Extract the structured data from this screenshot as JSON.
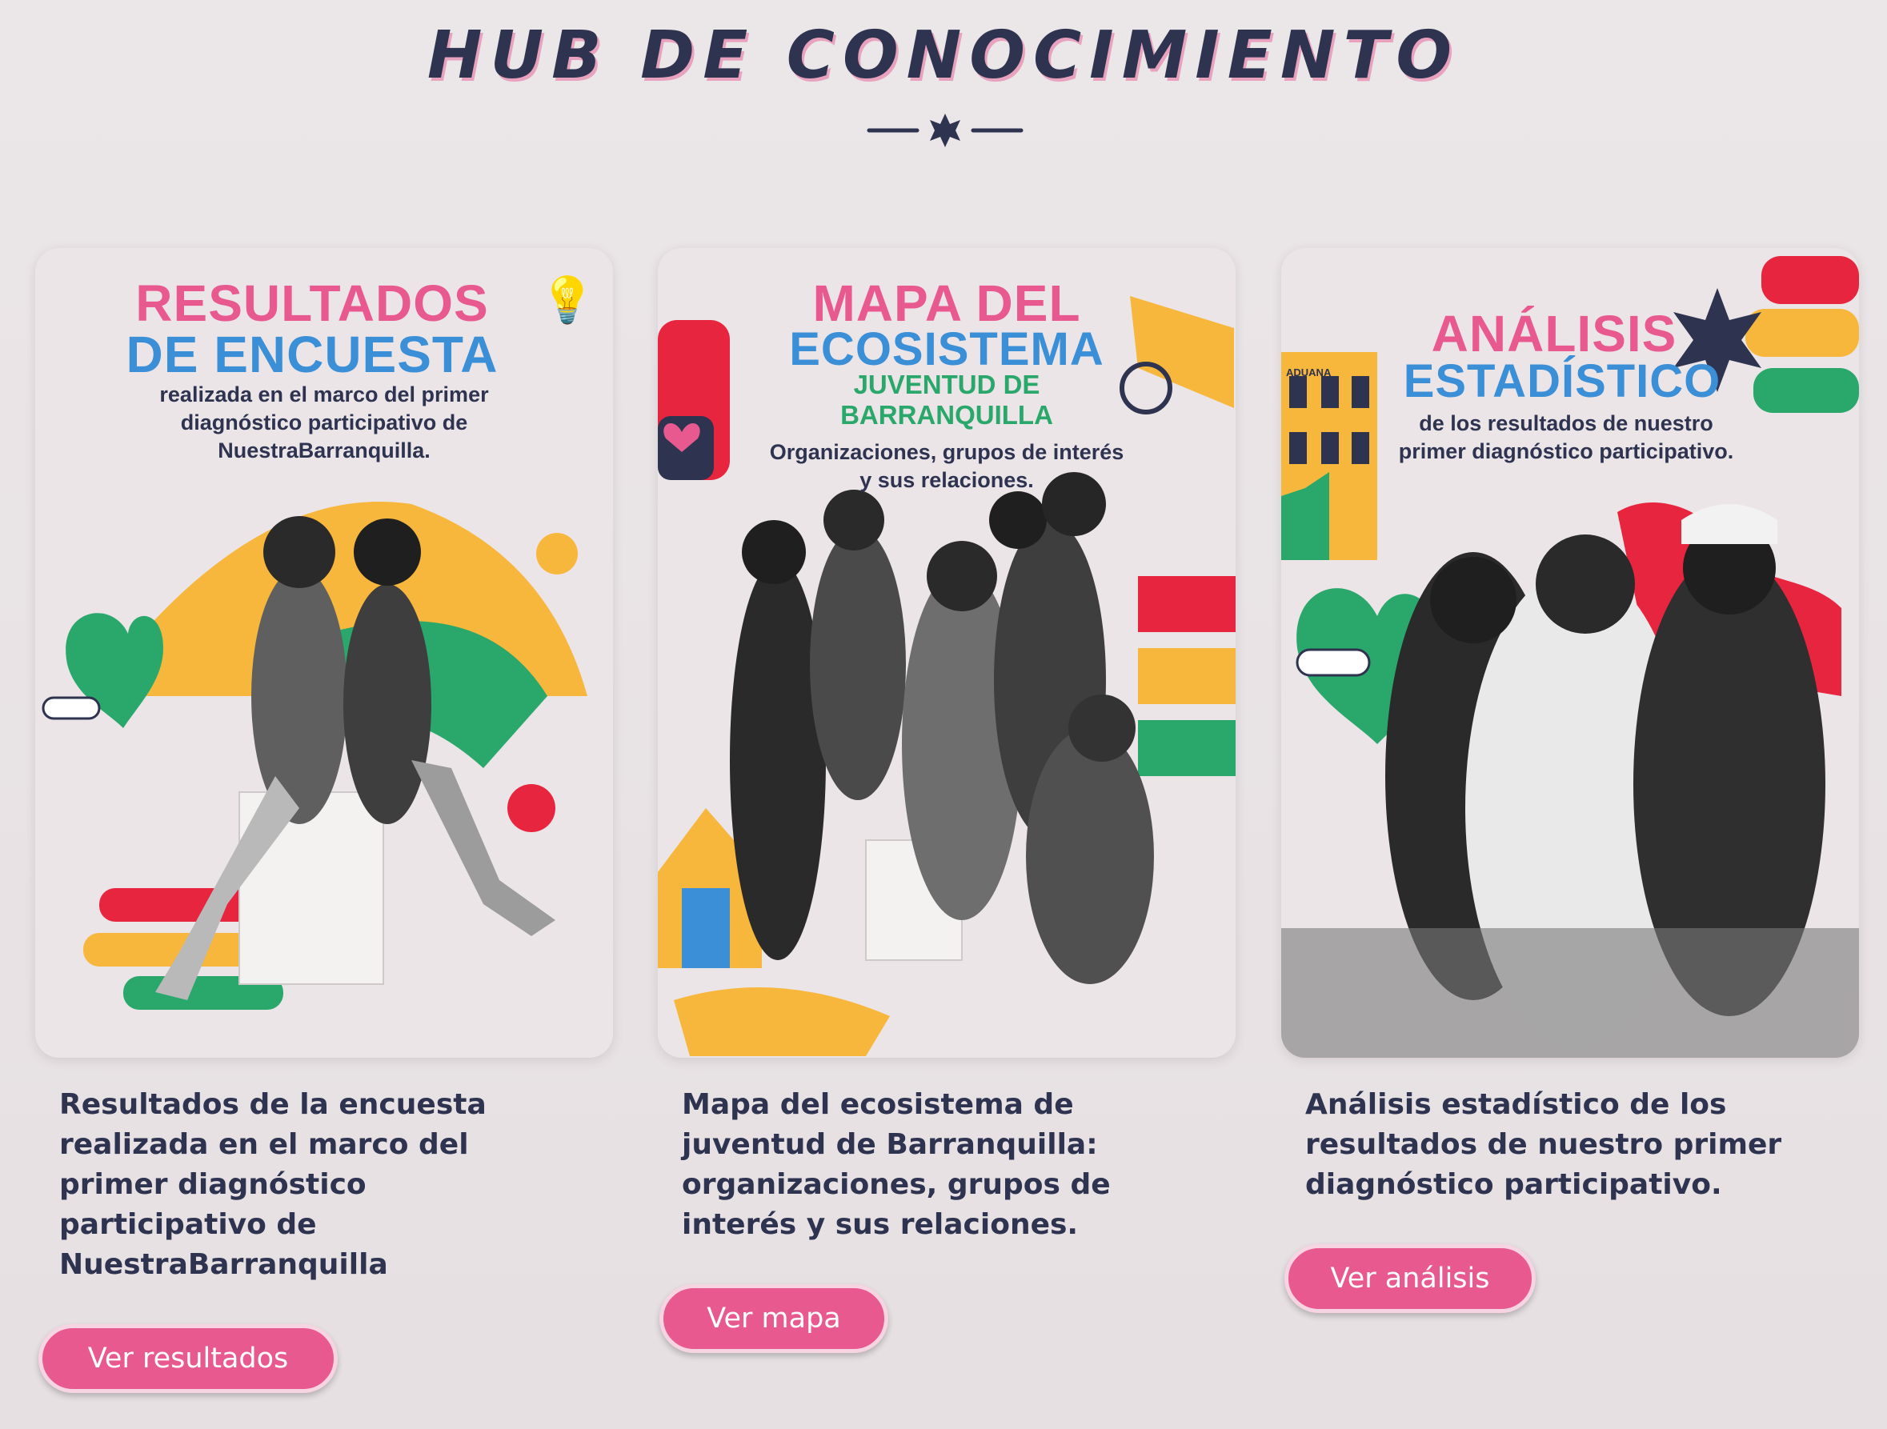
{
  "header": {
    "title": "HUB DE CONOCIMIENTO"
  },
  "colors": {
    "pink": "#e85a8f",
    "navy": "#2e3350",
    "blue": "#3a8fd6",
    "green": "#2aa86b",
    "yellow": "#f6b73c",
    "red": "#e8253f"
  },
  "cards": [
    {
      "poster": {
        "title_line1": "RESULTADOS",
        "title_line2": "DE ENCUESTA",
        "subtitle": "realizada en el marco del primer diagnóstico participativo de NuestraBarranquilla."
      },
      "description": "Resultados de la encuesta realizada en el marco del primer diagnóstico participativo de NuestraBarranquilla",
      "button_label": "Ver resultados"
    },
    {
      "poster": {
        "title_line1": "MAPA DEL",
        "title_line2": "ECOSISTEMA",
        "title_line3": "JUVENTUD DE",
        "title_line4": "BARRANQUILLA",
        "subtitle": "Organizaciones, grupos de interés y sus relaciones."
      },
      "description": "Mapa del ecosistema de juventud de Barranquilla: organizaciones, grupos de interés y sus relaciones.",
      "button_label": "Ver mapa"
    },
    {
      "poster": {
        "title_line1": "ANÁLISIS",
        "title_line2": "ESTADÍSTICO",
        "subtitle": "de los resultados de nuestro primer diagnóstico participativo.",
        "building_sign": "ADUANA"
      },
      "description": "Análisis estadístico de los resultados de nuestro primer diagnóstico participativo.",
      "button_label": "Ver análisis"
    }
  ]
}
